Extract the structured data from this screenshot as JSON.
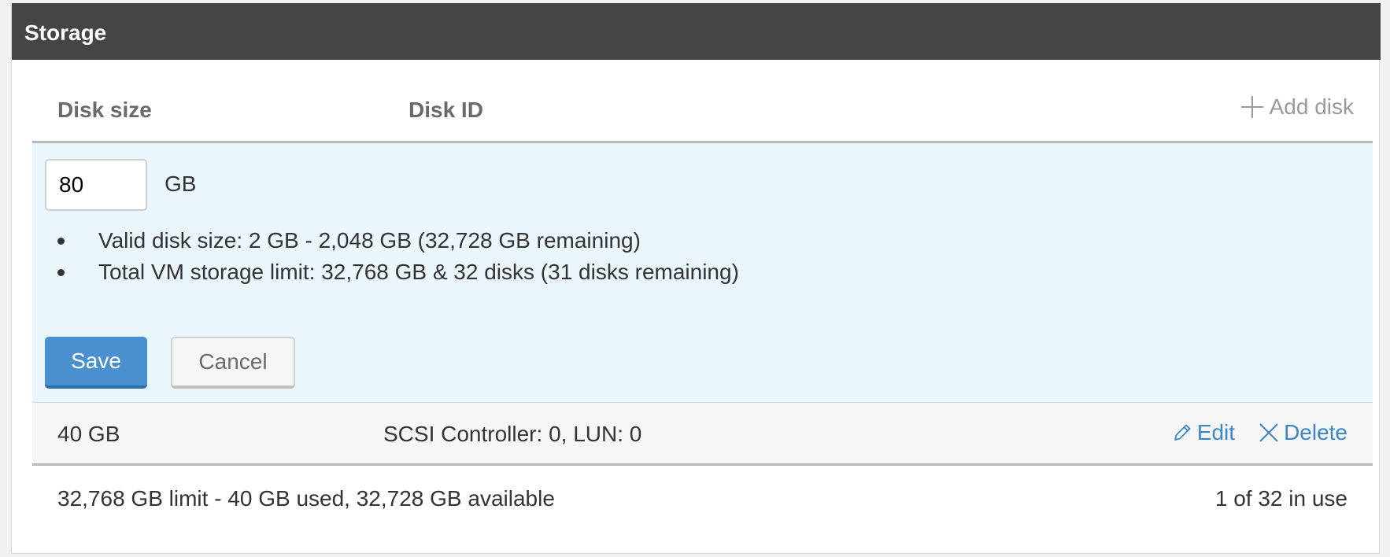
{
  "panel": {
    "title": "Storage"
  },
  "table": {
    "headers": {
      "disk_size": "Disk size",
      "disk_id": "Disk ID"
    },
    "add_disk_label": "Add disk",
    "add_disk_icon": "plus-icon"
  },
  "editor": {
    "size_value": "80",
    "unit": "GB",
    "rules": [
      "Valid disk size: 2 GB - 2,048 GB (32,728 GB remaining)",
      "Total VM storage limit: 32,768 GB & 32 disks (31 disks remaining)"
    ],
    "save_label": "Save",
    "cancel_label": "Cancel"
  },
  "disks": [
    {
      "size": "40 GB",
      "id": "SCSI Controller: 0, LUN: 0",
      "edit_label": "Edit",
      "delete_label": "Delete"
    }
  ],
  "summary": {
    "usage": "32,768 GB limit - 40 GB used, 32,728 GB available",
    "count": "1 of 32 in use"
  },
  "colors": {
    "header_bg": "#454545",
    "edit_bg": "#ebf5fc",
    "primary": "#4a90cf",
    "link": "#3b86c6"
  }
}
